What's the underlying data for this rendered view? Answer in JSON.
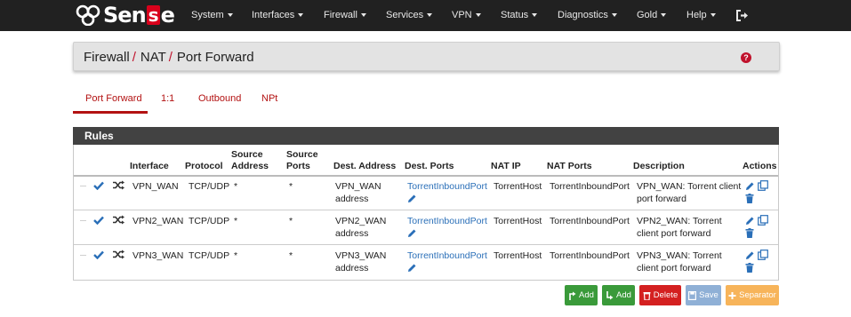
{
  "brand": {
    "logo_text_1": "Sen",
    "logo_text_2": "s",
    "logo_text_3": "e"
  },
  "nav": {
    "items": [
      {
        "label": "System"
      },
      {
        "label": "Interfaces"
      },
      {
        "label": "Firewall"
      },
      {
        "label": "Services"
      },
      {
        "label": "VPN"
      },
      {
        "label": "Status"
      },
      {
        "label": "Diagnostics"
      },
      {
        "label": "Gold"
      },
      {
        "label": "Help"
      }
    ]
  },
  "breadcrumb": {
    "part1": "Firewall",
    "part2": "NAT",
    "part3": "Port Forward",
    "sep": "/"
  },
  "tabs": [
    {
      "label": "Port Forward",
      "active": true
    },
    {
      "label": "1:1"
    },
    {
      "label": "Outbound"
    },
    {
      "label": "NPt"
    }
  ],
  "panel": {
    "title": "Rules"
  },
  "table": {
    "headers": {
      "interface": "Interface",
      "protocol": "Protocol",
      "source_address_1": "Source",
      "source_address_2": "Address",
      "source_ports_1": "Source",
      "source_ports_2": "Ports",
      "dest_address": "Dest. Address",
      "dest_ports": "Dest. Ports",
      "nat_ip": "NAT IP",
      "nat_ports": "NAT Ports",
      "description": "Description",
      "actions": "Actions"
    },
    "rows": [
      {
        "interface": "VPN_WAN",
        "protocol": "TCP/UDP",
        "source_address": "*",
        "source_ports": "*",
        "dest_address_1": "VPN_WAN",
        "dest_address_2": "address",
        "dest_ports": "TorrentInboundPort",
        "nat_ip": "TorrentHost",
        "nat_ports": "TorrentInboundPort",
        "description_1": "VPN_WAN: Torrent client",
        "description_2": "port forward"
      },
      {
        "interface": "VPN2_WAN",
        "protocol": "TCP/UDP",
        "source_address": "*",
        "source_ports": "*",
        "dest_address_1": "VPN2_WAN",
        "dest_address_2": "address",
        "dest_ports": "TorrentInboundPort",
        "nat_ip": "TorrentHost",
        "nat_ports": "TorrentInboundPort",
        "description_1": "VPN2_WAN: Torrent",
        "description_2": "client port forward"
      },
      {
        "interface": "VPN3_WAN",
        "protocol": "TCP/UDP",
        "source_address": "*",
        "source_ports": "*",
        "dest_address_1": "VPN3_WAN",
        "dest_address_2": "address",
        "dest_ports": "TorrentInboundPort",
        "nat_ip": "TorrentHost",
        "nat_ports": "TorrentInboundPort",
        "description_1": "VPN3_WAN: Torrent",
        "description_2": "client port forward"
      }
    ]
  },
  "buttons": {
    "add_top": "Add",
    "add_bottom": "Add",
    "delete": "Delete",
    "save": "Save",
    "separator": "Separator"
  },
  "colors": {
    "navbar": "#212121",
    "accent_red": "#b31212",
    "link_blue": "#2a6fb8",
    "check_blue": "#2a6fb8",
    "btn_green": "#3a9a3a",
    "btn_red": "#d42020",
    "btn_blue": "#8fb0d6",
    "btn_orange": "#f7b45a"
  },
  "icons": [
    "logo-symbol-icon",
    "caret-down-icon",
    "logout-icon",
    "help-icon",
    "check-icon",
    "shuffle-icon",
    "pencil-icon",
    "copy-icon",
    "trash-icon",
    "add-above-icon",
    "add-below-icon",
    "trash-icon",
    "save-icon",
    "plus-icon"
  ]
}
